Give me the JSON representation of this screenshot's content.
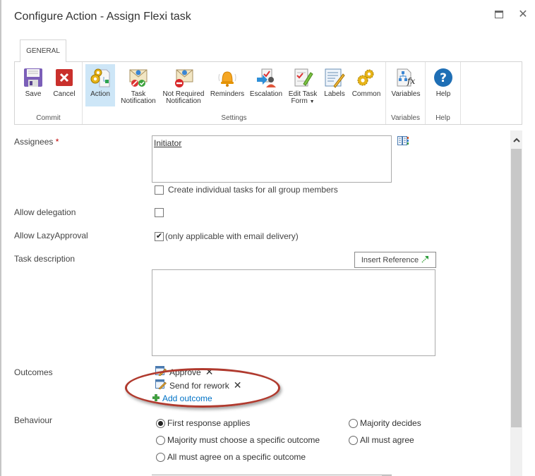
{
  "dialog": {
    "title": "Configure Action - Assign Flexi task",
    "maximize_icon": "maximize-icon",
    "close_icon": "close-icon"
  },
  "ribbon": {
    "tab": "GENERAL",
    "groups": [
      {
        "label": "Commit",
        "buttons": [
          {
            "label": "Save",
            "icon": "floppy-disk-icon"
          },
          {
            "label": "Cancel",
            "icon": "cancel-x-icon"
          }
        ]
      },
      {
        "label": "Settings",
        "buttons": [
          {
            "label": "Action",
            "icon": "gears-document-icon",
            "active": true
          },
          {
            "label_line1": "Task",
            "label_line2": "Notification",
            "icon": "envelope-notification-icon"
          },
          {
            "label_line1": "Not Required",
            "label_line2": "Notification",
            "icon": "envelope-no-entry-icon"
          },
          {
            "label": "Reminders",
            "icon": "bell-icon"
          },
          {
            "label": "Escalation",
            "icon": "escalation-icon"
          },
          {
            "label_line1": "Edit Task",
            "label_line2": "Form",
            "icon": "edit-form-icon",
            "has_dropdown": true
          },
          {
            "label": "Labels",
            "icon": "labels-pencil-icon"
          },
          {
            "label": "Common",
            "icon": "gears-icon"
          }
        ]
      },
      {
        "label": "Variables",
        "buttons": [
          {
            "label": "Variables",
            "icon": "variables-fx-icon"
          }
        ]
      },
      {
        "label": "Help",
        "buttons": [
          {
            "label": "Help",
            "icon": "help-question-icon"
          }
        ]
      }
    ]
  },
  "form": {
    "assignees": {
      "label": "Assignees",
      "required_marker": "*",
      "value": "Initiator",
      "address_book_icon": "address-book-icon",
      "individual_tasks_label": "Create individual tasks for all group members",
      "individual_tasks_checked": false
    },
    "allow_delegation": {
      "label": "Allow delegation",
      "checked": false
    },
    "allow_lazy_approval": {
      "label": "Allow LazyApproval",
      "checked": true,
      "note": "(only applicable with email delivery)"
    },
    "task_description": {
      "label": "Task description",
      "insert_reference_label": "Insert Reference",
      "value": ""
    },
    "outcomes": {
      "label": "Outcomes",
      "items": [
        {
          "label": "Approve"
        },
        {
          "label": "Send for rework"
        }
      ],
      "add_label": "Add outcome",
      "remove_glyph": "✕"
    },
    "behaviour": {
      "label": "Behaviour",
      "options": [
        {
          "label": "First response applies",
          "selected": true
        },
        {
          "label": "Majority decides",
          "selected": false
        },
        {
          "label": "Majority must choose a specific outcome",
          "selected": false
        },
        {
          "label": "All must agree",
          "selected": false
        },
        {
          "label": "All must agree on a specific outcome",
          "selected": false
        }
      ]
    }
  },
  "highlight": {
    "color": "#b03a2e"
  }
}
